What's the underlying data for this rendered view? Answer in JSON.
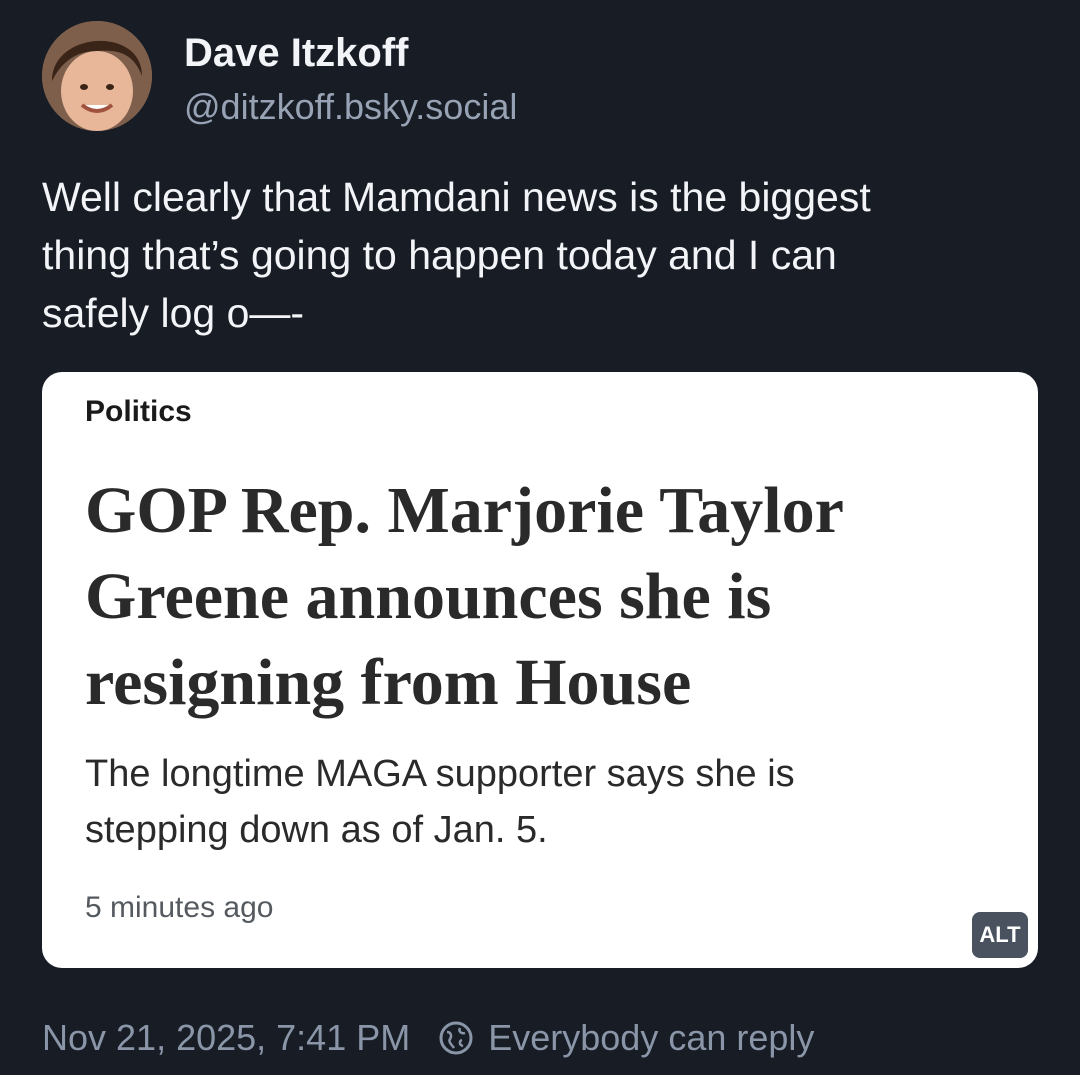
{
  "author": {
    "display_name": "Dave Itzkoff",
    "handle": "@ditzkoff.bsky.social"
  },
  "post": {
    "text": "Well clearly that Mamdani news is the biggest\nthing that’s going to happen today and I can\nsafely log o—-"
  },
  "embed": {
    "section": "Politics",
    "headline": "GOP Rep. Marjorie Taylor\nGreene announces she is\nresigning from House",
    "dek": "The longtime MAGA supporter says she is\nstepping down as of Jan. 5.",
    "time": "5 minutes ago",
    "alt_label": "ALT"
  },
  "footer": {
    "timestamp": "Nov 21, 2025, 7:41 PM",
    "reply_setting": "Everybody can reply",
    "reply_icon": "globe-icon"
  },
  "colors": {
    "background": "#171c25",
    "primary_text": "#f2f4f7",
    "secondary_text": "#97a3b4",
    "card_background": "#ffffff",
    "alt_badge": "#4a5260"
  }
}
